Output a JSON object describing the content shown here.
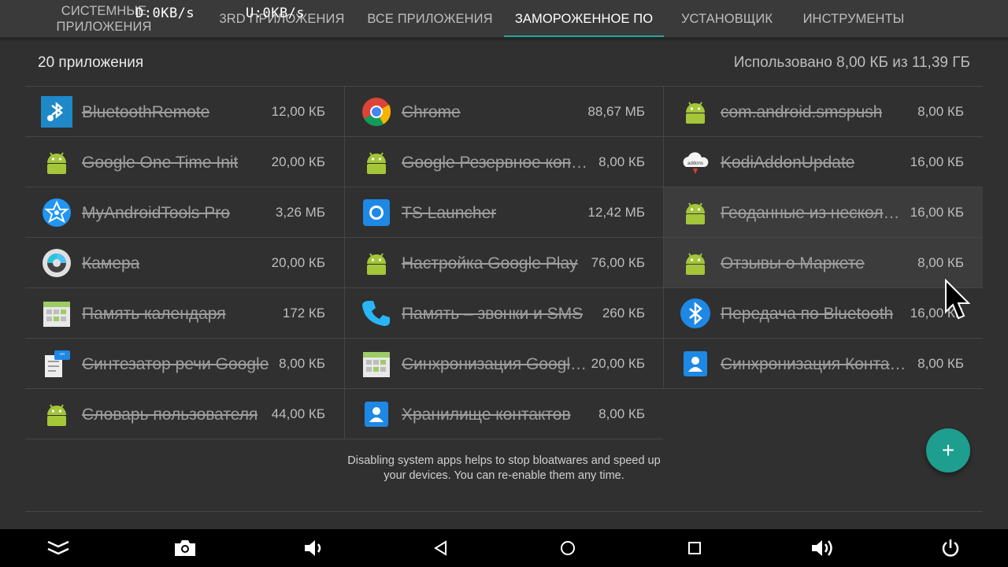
{
  "tabs": [
    {
      "label": "СИСТЕМНЫЕ ПРИЛОЖЕНИЯ",
      "active": false
    },
    {
      "label": "3RD ПРИЛОЖЕНИЯ",
      "active": false
    },
    {
      "label": "ВСЕ ПРИЛОЖЕНИЯ",
      "active": false
    },
    {
      "label": "ЗАМОРОЖЕННОЕ ПО",
      "active": true
    },
    {
      "label": "УСТАНОВЩИК",
      "active": false
    },
    {
      "label": "ИНСТРУМЕНТЫ",
      "active": false
    }
  ],
  "status": {
    "download": "D:0KB/s",
    "upload": "U:0KB/s"
  },
  "header": {
    "count": "20 приложения",
    "usage": "Использовано 8,00 КБ из 11,39 ГБ"
  },
  "apps": [
    {
      "name": "BluetoothRemote",
      "size": "12,00 КБ",
      "icon": "bluetooth-remote-icon"
    },
    {
      "name": "Chrome",
      "size": "88,67 МБ",
      "icon": "chrome-icon"
    },
    {
      "name": "com.android.smspush",
      "size": "8,00 КБ",
      "icon": "android-icon"
    },
    {
      "name": "Google One Time Init",
      "size": "20,00 КБ",
      "icon": "android-icon"
    },
    {
      "name": "Google Резервное копирование",
      "size": "8,00 КБ",
      "icon": "android-icon"
    },
    {
      "name": "KodiAddonUpdate",
      "size": "16,00 КБ",
      "icon": "addons-cloud-icon"
    },
    {
      "name": "MyAndroidTools Pro",
      "size": "3,26 МБ",
      "icon": "myandroidtools-icon"
    },
    {
      "name": "TS Launcher",
      "size": "12,42 МБ",
      "icon": "ts-launcher-icon"
    },
    {
      "name": "Геоданные из нескольких источников",
      "size": "16,00 КБ",
      "icon": "android-icon"
    },
    {
      "name": "Камера",
      "size": "20,00 КБ",
      "icon": "camera-lens-icon"
    },
    {
      "name": "Настройка Google Play",
      "size": "76,00 КБ",
      "icon": "android-icon"
    },
    {
      "name": "Отзывы о Маркете",
      "size": "8,00 КБ",
      "icon": "android-icon"
    },
    {
      "name": "Память календаря",
      "size": "172 КБ",
      "icon": "calendar-storage-icon"
    },
    {
      "name": "Память – звонки и SMS",
      "size": "260 КБ",
      "icon": "phone-icon"
    },
    {
      "name": "Передача по Bluetooth",
      "size": "16,00 КБ",
      "icon": "bluetooth-icon"
    },
    {
      "name": "Синтезатор речи Google",
      "size": "8,00 КБ",
      "icon": "text-to-speech-icon"
    },
    {
      "name": "Синхронизация Google Календаря",
      "size": "20,00 КБ",
      "icon": "calendar-storage-icon"
    },
    {
      "name": "Синхронизация Контактов",
      "size": "8,00 КБ",
      "icon": "contacts-icon"
    },
    {
      "name": "Словарь пользователя",
      "size": "44,00 КБ",
      "icon": "android-icon"
    },
    {
      "name": "Хранилище контактов",
      "size": "8,00 КБ",
      "icon": "contacts-icon"
    }
  ],
  "note": "Disabling system apps helps to stop bloatwares and speed up your devices. You can re-enable them any time.",
  "fab": {
    "label": "+"
  },
  "navbar": [
    "collapse-icon",
    "screenshot-icon",
    "volume-down-icon",
    "back-icon",
    "home-icon",
    "recents-icon",
    "volume-up-icon",
    "power-icon"
  ],
  "colors": {
    "accent": "#26a69a",
    "fab": "#1e9e8e",
    "android": "#a4c639"
  }
}
